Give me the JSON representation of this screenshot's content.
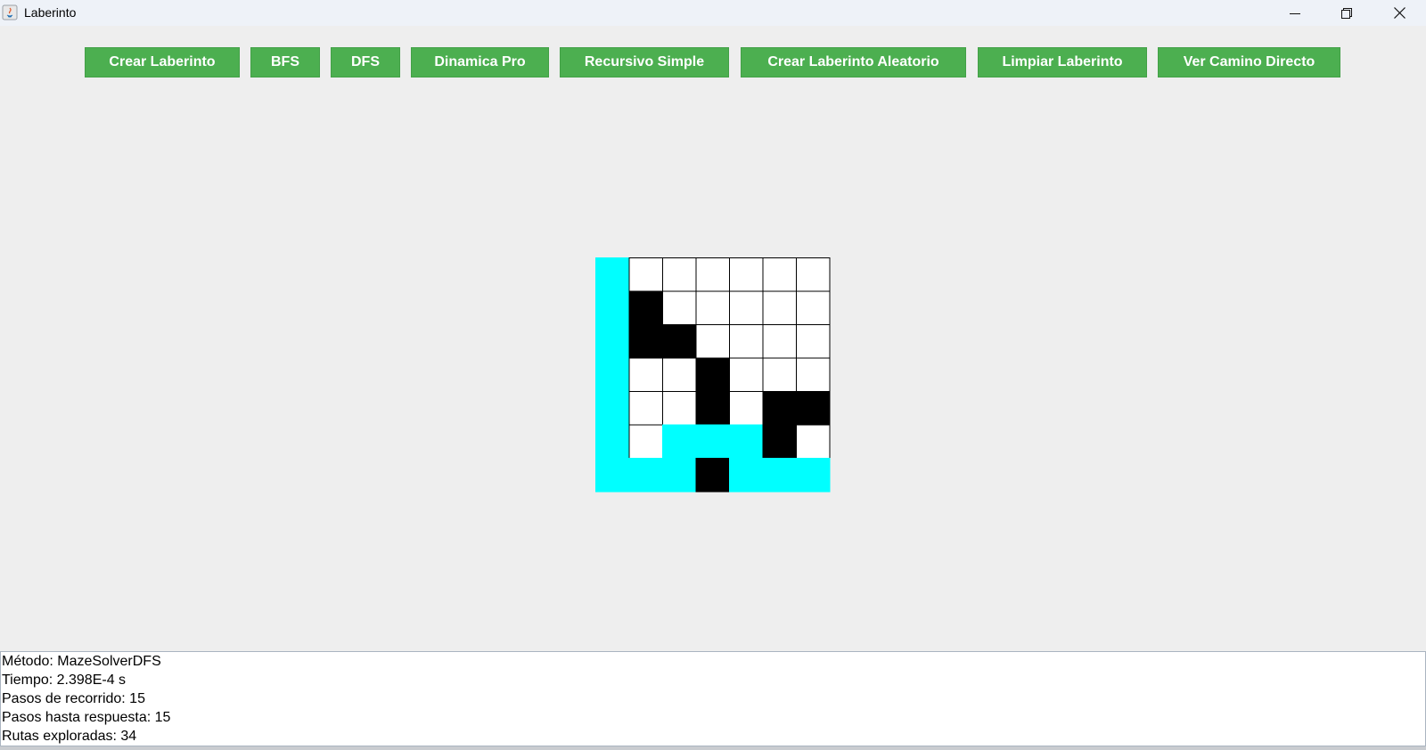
{
  "window": {
    "title": "Laberinto"
  },
  "toolbar": {
    "buttons": [
      {
        "label": "Crear Laberinto"
      },
      {
        "label": "BFS"
      },
      {
        "label": "DFS"
      },
      {
        "label": "Dinamica Pro"
      },
      {
        "label": "Recursivo Simple"
      },
      {
        "label": "Crear Laberinto Aleatorio"
      },
      {
        "label": "Limpiar Laberinto"
      },
      {
        "label": "Ver Camino Directo"
      }
    ],
    "button_color": "#4caf50"
  },
  "maze": {
    "rows": 7,
    "cols": 7,
    "legend": {
      "w": "free",
      "b": "wall",
      "c": "path"
    },
    "cells": [
      [
        "c",
        "w",
        "w",
        "w",
        "w",
        "w",
        "w"
      ],
      [
        "c",
        "b",
        "w",
        "w",
        "w",
        "w",
        "w"
      ],
      [
        "c",
        "b",
        "b",
        "w",
        "w",
        "w",
        "w"
      ],
      [
        "c",
        "w",
        "w",
        "b",
        "w",
        "w",
        "w"
      ],
      [
        "c",
        "w",
        "w",
        "b",
        "w",
        "b",
        "b"
      ],
      [
        "c",
        "w",
        "c",
        "c",
        "c",
        "b",
        "w"
      ],
      [
        "c",
        "c",
        "c",
        "b",
        "c",
        "c",
        "c"
      ]
    ],
    "colors": {
      "free": "#ffffff",
      "wall": "#000000",
      "path": "#00ffff"
    }
  },
  "output": {
    "lines": [
      "Método: MazeSolverDFS",
      "Tiempo: 2.398E-4 s",
      "Pasos de recorrido: 15",
      "Pasos hasta respuesta: 15",
      "Rutas exploradas: 34"
    ]
  }
}
